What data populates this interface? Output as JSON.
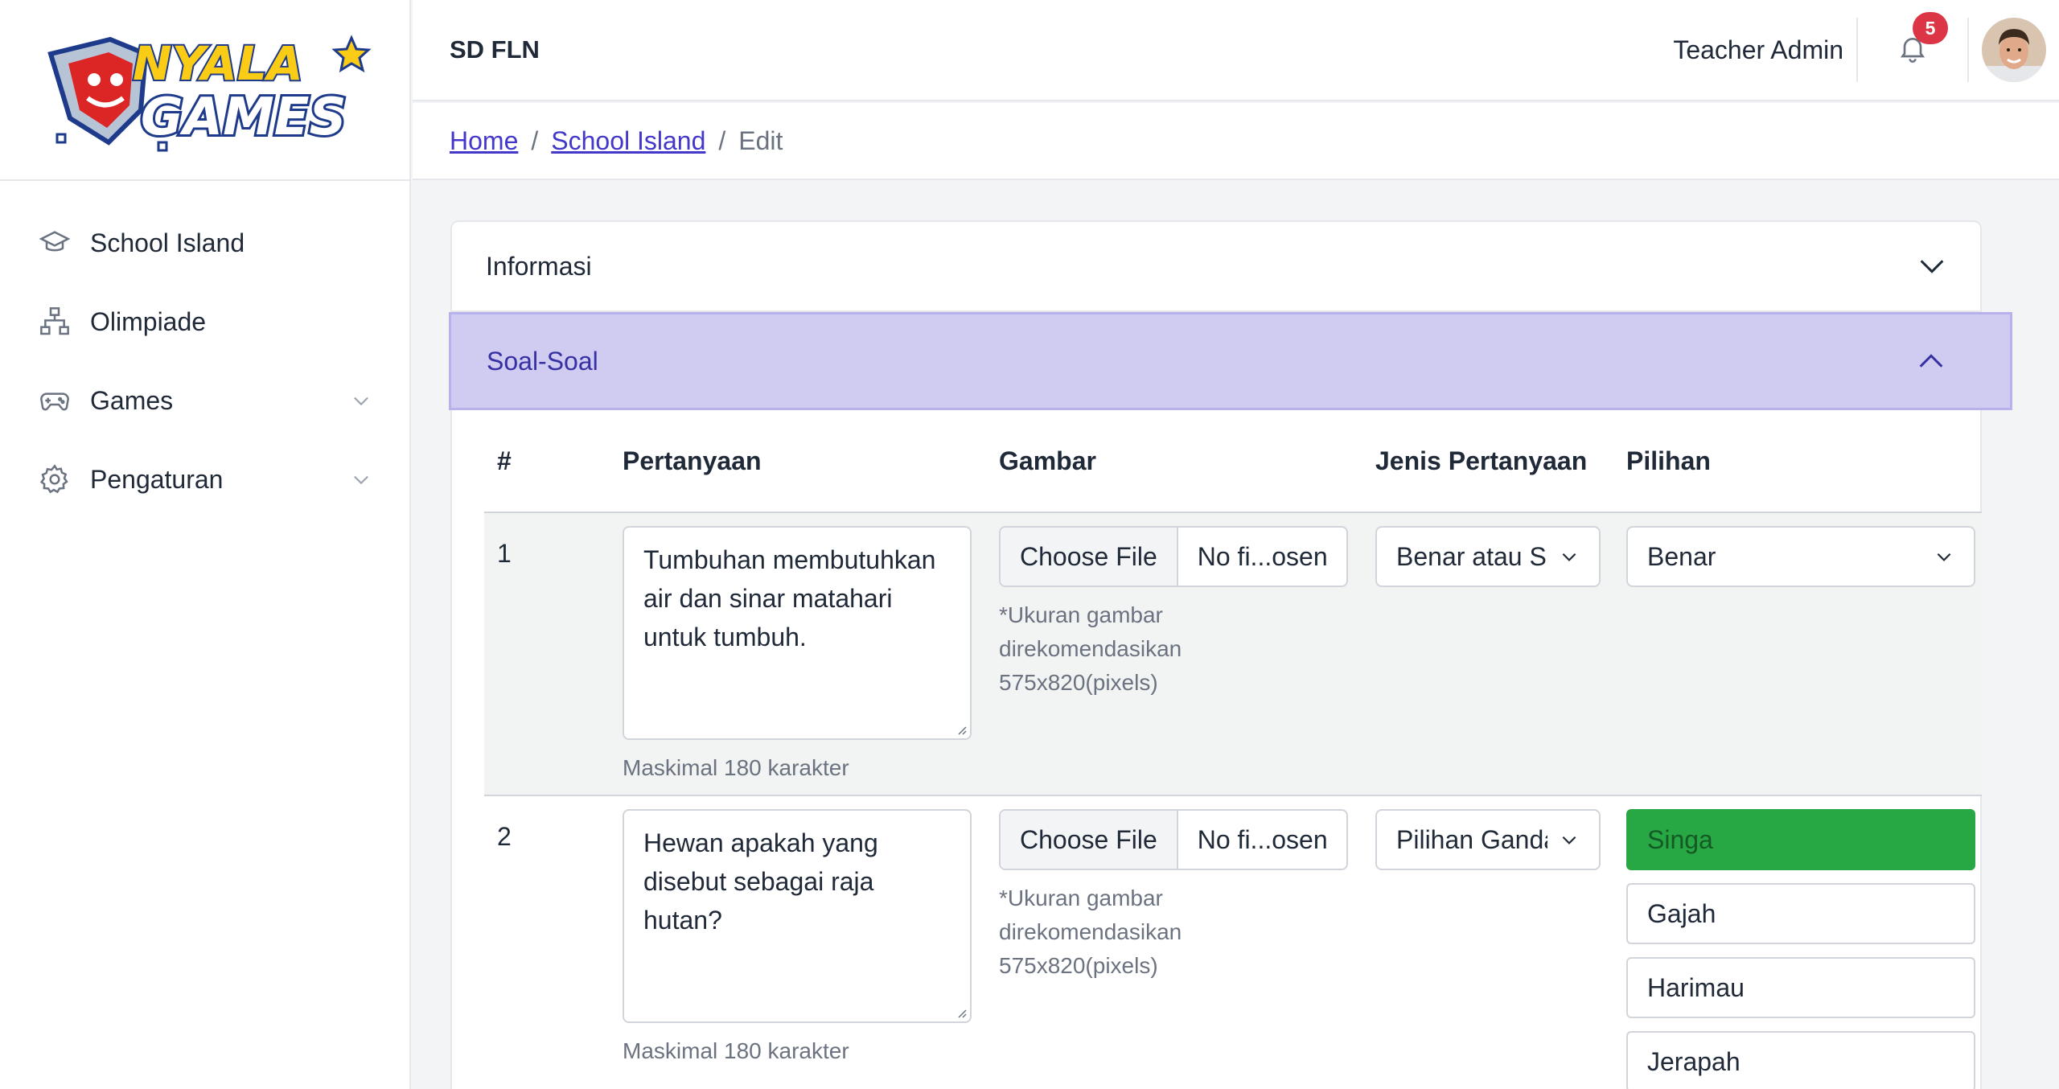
{
  "sidebar": {
    "logo_text": "NYALA GAMES",
    "items": [
      {
        "label": "School Island",
        "icon": "graduation-cap-icon"
      },
      {
        "label": "Olimpiade",
        "icon": "hierarchy-icon"
      },
      {
        "label": "Games",
        "icon": "gamepad-icon"
      },
      {
        "label": "Pengaturan",
        "icon": "gear-icon"
      }
    ]
  },
  "header": {
    "school_name": "SD FLN",
    "user_name": "Teacher Admin",
    "notification_count": "5"
  },
  "breadcrumb": {
    "home": "Home",
    "section": "School Island",
    "current": "Edit",
    "separator": "/"
  },
  "accordion": {
    "info_title": "Informasi",
    "questions_title": "Soal-Soal"
  },
  "table": {
    "headers": {
      "num": "#",
      "question": "Pertanyaan",
      "image": "Gambar",
      "type": "Jenis Pertanyaan",
      "options": "Pilihan"
    },
    "rows": [
      {
        "num": "1",
        "question": "Tumbuhan membutuhkan air dan sinar matahari untuk tumbuh.",
        "question_help": "Maskimal 180 karakter",
        "file_button": "Choose File",
        "file_status": "No fi...osen",
        "image_help": "*Ukuran gambar direkomendasikan 575x820(pixels)",
        "type": "Benar atau Salah",
        "answer": "Benar"
      },
      {
        "num": "2",
        "question": "Hewan apakah yang disebut sebagai raja hutan?",
        "question_help": "Maskimal 180 karakter",
        "file_button": "Choose File",
        "file_status": "No fi...osen",
        "image_help": "*Ukuran gambar direkomendasikan 575x820(pixels)",
        "type": "Pilihan Ganda",
        "options": [
          "Singa",
          "Gajah",
          "Harimau",
          "Jerapah"
        ],
        "correct_option": "Singa"
      }
    ]
  },
  "colors": {
    "accent": "#4338ca",
    "active_section_bg": "#cfcbf1",
    "correct_option": "#28a745",
    "badge": "#dc3545"
  }
}
